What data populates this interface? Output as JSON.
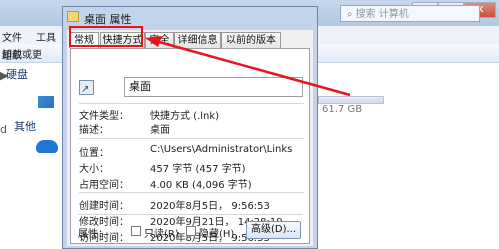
{
  "background": {
    "search_placeholder": "搜索 计算机",
    "search_icon": "search-icon",
    "menu": [
      "文件",
      "工具"
    ],
    "toolbar": [
      "组织",
      "卸载或更"
    ],
    "nav": [
      "硬盘",
      "其他"
    ],
    "left_glyphs": [
      "▶",
      "d",
      "▶"
    ],
    "drive_size": "61.7 GB",
    "window_buttons": [
      "—",
      "□",
      "✕"
    ]
  },
  "dialog": {
    "title": "桌面 属性",
    "tabs": [
      "常规",
      "快捷方式",
      "安全",
      "详细信息",
      "以前的版本"
    ],
    "active_tab": "常规",
    "highlighted_tab": "快捷方式",
    "name": "桌面",
    "properties": [
      {
        "label": "文件类型：",
        "value": "快捷方式 (.lnk)"
      },
      {
        "label": "描述：",
        "value": "桌面"
      },
      {
        "label": "位置：",
        "value": "C:\\Users\\Administrator\\Links"
      },
      {
        "label": "大小：",
        "value": "457 字节 (457 字节)"
      },
      {
        "label": "占用空间：",
        "value": "4.00 KB (4,096 字节)"
      },
      {
        "label": "创建时间：",
        "value": "2020年8月5日， 9:56:53"
      },
      {
        "label": "修改时间：",
        "value": "2020年9月21日， 14:28:19"
      },
      {
        "label": "访问时间：",
        "value": "2020年8月5日， 9:56:53"
      }
    ],
    "attributes_label": "属性：",
    "readonly_label": "只读(R)",
    "hidden_label": "隐藏(H)",
    "advanced_label": "高级(D)..."
  },
  "colors": {
    "highlight": "#e8141c",
    "dialog_frame": "#c3d4ea"
  }
}
